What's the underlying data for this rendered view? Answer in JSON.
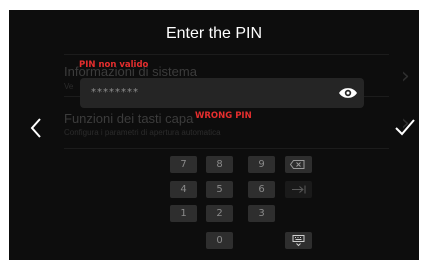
{
  "dialog": {
    "title": "Enter the PIN",
    "pin_value": "********",
    "error_top": "PIN non valido",
    "error_bottom": "WRONG PIN"
  },
  "background": {
    "items": [
      {
        "title": "Informazioni di sistema",
        "subtitle": "Ve"
      },
      {
        "title": "Funzioni dei tasti capa",
        "subtitle": "Configura i parametri di apertura automatica"
      }
    ]
  },
  "keypad": {
    "row1": [
      "7",
      "8",
      "9"
    ],
    "row2": [
      "4",
      "5",
      "6"
    ],
    "row3": [
      "1",
      "2",
      "3"
    ],
    "row4": [
      "0"
    ]
  },
  "colors": {
    "background": "#0d0d0d",
    "error": "#e52e2e",
    "field": "#252525",
    "key": "#2e2e2e"
  }
}
